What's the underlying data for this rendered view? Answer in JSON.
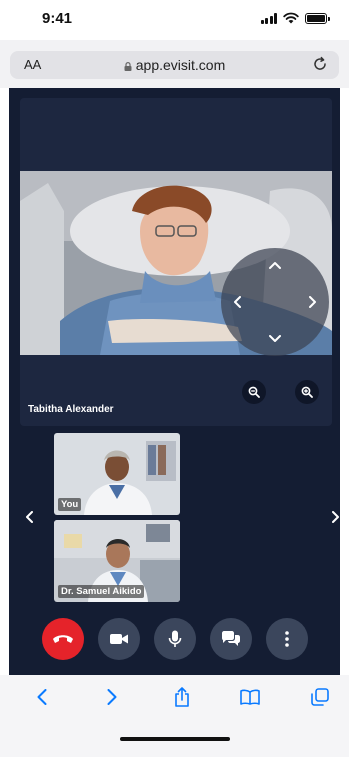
{
  "status_bar": {
    "time": "9:41"
  },
  "browser": {
    "text_size_label": "AA",
    "url": "app.evisit.com"
  },
  "call": {
    "main_participant": {
      "name": "Tabitha Alexander"
    },
    "thumbnails": [
      {
        "label": "You"
      },
      {
        "label": "Dr. Samuel Aikido"
      }
    ]
  },
  "colors": {
    "call_background": "#141d33",
    "end_call": "#e5232a",
    "control_button": "#3b465c",
    "ios_blue": "#0a7aff"
  },
  "icons": {
    "end_call": "phone-hangup-icon",
    "camera": "video-camera-icon",
    "microphone": "microphone-icon",
    "chat": "chat-bubbles-icon",
    "more": "vertical-dots-icon",
    "zoom_out": "zoom-out-icon",
    "zoom_in": "zoom-in-icon"
  }
}
